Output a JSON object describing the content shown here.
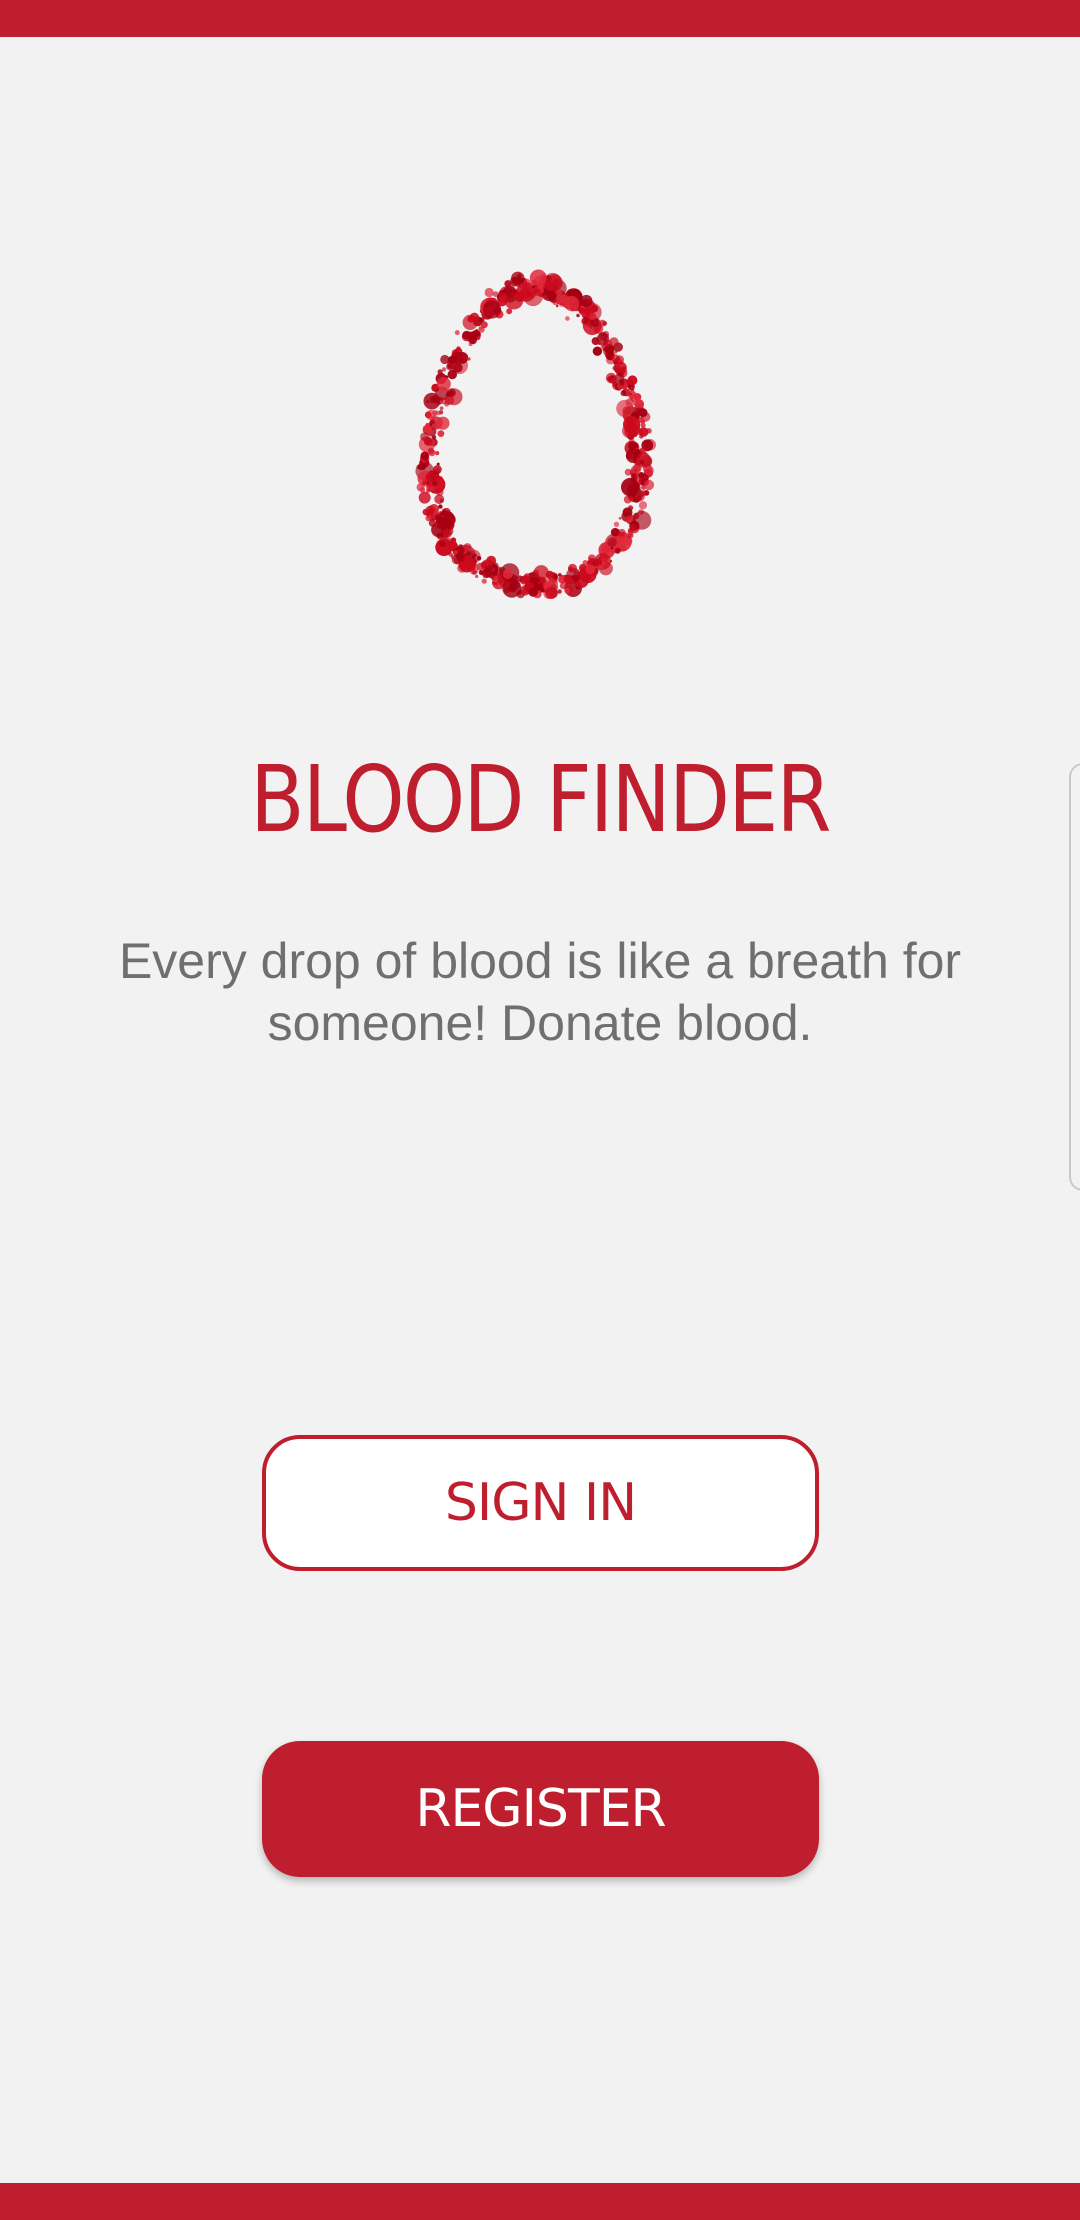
{
  "app": {
    "title": "BLOOD FINDER",
    "tagline": "Every drop of blood is like a breath for someone! Donate blood.",
    "logo_icon": "blood-drop-icon"
  },
  "actions": {
    "sign_in_label": "SIGN IN",
    "register_label": "REGISTER"
  },
  "colors": {
    "brand_red": "#be1e2d",
    "background": "#f2f2f2",
    "text_gray": "#6f6f6f"
  }
}
